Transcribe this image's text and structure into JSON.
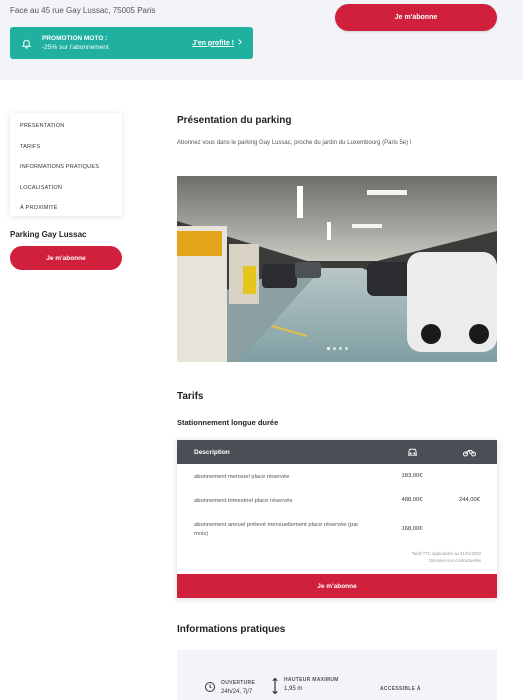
{
  "header": {
    "address": "Face au 45 rue Gay Lussac, 75005 Paris",
    "subscribe_label": "Je m'abonne"
  },
  "promo": {
    "title": "PROMOTION MOTO :",
    "subtitle": "-25% sur l'abonnement",
    "cta": "J'en profite !",
    "color": "#1fb09f"
  },
  "sidebar": {
    "items": [
      {
        "label": "PRÉSENTATION"
      },
      {
        "label": "TARIFS"
      },
      {
        "label": "INFORMATIONS PRATIQUES"
      },
      {
        "label": "LOCALISATION"
      },
      {
        "label": "À PROXIMITÉ"
      }
    ],
    "parking_name": "Parking Gay Lussac",
    "subscribe_label": "Je m'abonne"
  },
  "presentation": {
    "title": "Présentation du parking",
    "text": "Abonnez vous dans le parking Gay Lussac, proche du jardin du Luxembourg (Paris 5e) !"
  },
  "tarifs": {
    "title": "Tarifs",
    "subtitle": "Stationnement longue durée",
    "columns": {
      "description": "Description",
      "car_icon": "car-icon",
      "moto_icon": "motorbike-icon"
    },
    "rows": [
      {
        "description": "abonnement mensuel place réservée",
        "car": "183,00€",
        "moto": ""
      },
      {
        "description": "abonnement trimestriel place réservée",
        "car": "488,00€",
        "moto": "244,00€"
      },
      {
        "description": "abonnement annuel prélevé mensuellement place réservée (par mois)",
        "car": "168,00€",
        "moto": ""
      }
    ],
    "note_line1": "Tarifs TTC applicables au 01/01/2023",
    "note_line2": "Données non contractuelles",
    "subscribe_label": "Je m'abonne"
  },
  "infos": {
    "title": "Informations pratiques",
    "opening_label": "OUVERTURE",
    "opening_value": "24h/24, 7j/7",
    "height_label": "HAUTEUR MAXIMUM",
    "height_value": "1,95 m",
    "access_label": "ACCESSIBLE À"
  },
  "colors": {
    "accent": "#d1203e",
    "dark_header": "#4a4f56",
    "band": "#f3f4f7"
  }
}
